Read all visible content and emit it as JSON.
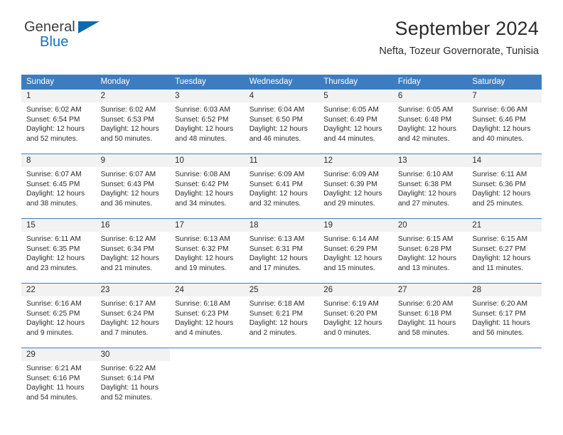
{
  "brand": {
    "word1": "General",
    "word2": "Blue",
    "triangle_icon": "triangle-icon",
    "accent_color": "#1069ae"
  },
  "header": {
    "title": "September 2024",
    "subtitle": "Nefta, Tozeur Governorate, Tunisia"
  },
  "theme": {
    "header_bg": "#3d7dbf",
    "header_text": "#ffffff",
    "daynum_band": "#f2f2f2",
    "row_divider": "#3d7dbf"
  },
  "calendar": {
    "weekday_headers": [
      "Sunday",
      "Monday",
      "Tuesday",
      "Wednesday",
      "Thursday",
      "Friday",
      "Saturday"
    ],
    "weeks": [
      [
        {
          "day": "1",
          "sunrise": "Sunrise: 6:02 AM",
          "sunset": "Sunset: 6:54 PM",
          "daylight1": "Daylight: 12 hours",
          "daylight2": "and 52 minutes."
        },
        {
          "day": "2",
          "sunrise": "Sunrise: 6:02 AM",
          "sunset": "Sunset: 6:53 PM",
          "daylight1": "Daylight: 12 hours",
          "daylight2": "and 50 minutes."
        },
        {
          "day": "3",
          "sunrise": "Sunrise: 6:03 AM",
          "sunset": "Sunset: 6:52 PM",
          "daylight1": "Daylight: 12 hours",
          "daylight2": "and 48 minutes."
        },
        {
          "day": "4",
          "sunrise": "Sunrise: 6:04 AM",
          "sunset": "Sunset: 6:50 PM",
          "daylight1": "Daylight: 12 hours",
          "daylight2": "and 46 minutes."
        },
        {
          "day": "5",
          "sunrise": "Sunrise: 6:05 AM",
          "sunset": "Sunset: 6:49 PM",
          "daylight1": "Daylight: 12 hours",
          "daylight2": "and 44 minutes."
        },
        {
          "day": "6",
          "sunrise": "Sunrise: 6:05 AM",
          "sunset": "Sunset: 6:48 PM",
          "daylight1": "Daylight: 12 hours",
          "daylight2": "and 42 minutes."
        },
        {
          "day": "7",
          "sunrise": "Sunrise: 6:06 AM",
          "sunset": "Sunset: 6:46 PM",
          "daylight1": "Daylight: 12 hours",
          "daylight2": "and 40 minutes."
        }
      ],
      [
        {
          "day": "8",
          "sunrise": "Sunrise: 6:07 AM",
          "sunset": "Sunset: 6:45 PM",
          "daylight1": "Daylight: 12 hours",
          "daylight2": "and 38 minutes."
        },
        {
          "day": "9",
          "sunrise": "Sunrise: 6:07 AM",
          "sunset": "Sunset: 6:43 PM",
          "daylight1": "Daylight: 12 hours",
          "daylight2": "and 36 minutes."
        },
        {
          "day": "10",
          "sunrise": "Sunrise: 6:08 AM",
          "sunset": "Sunset: 6:42 PM",
          "daylight1": "Daylight: 12 hours",
          "daylight2": "and 34 minutes."
        },
        {
          "day": "11",
          "sunrise": "Sunrise: 6:09 AM",
          "sunset": "Sunset: 6:41 PM",
          "daylight1": "Daylight: 12 hours",
          "daylight2": "and 32 minutes."
        },
        {
          "day": "12",
          "sunrise": "Sunrise: 6:09 AM",
          "sunset": "Sunset: 6:39 PM",
          "daylight1": "Daylight: 12 hours",
          "daylight2": "and 29 minutes."
        },
        {
          "day": "13",
          "sunrise": "Sunrise: 6:10 AM",
          "sunset": "Sunset: 6:38 PM",
          "daylight1": "Daylight: 12 hours",
          "daylight2": "and 27 minutes."
        },
        {
          "day": "14",
          "sunrise": "Sunrise: 6:11 AM",
          "sunset": "Sunset: 6:36 PM",
          "daylight1": "Daylight: 12 hours",
          "daylight2": "and 25 minutes."
        }
      ],
      [
        {
          "day": "15",
          "sunrise": "Sunrise: 6:11 AM",
          "sunset": "Sunset: 6:35 PM",
          "daylight1": "Daylight: 12 hours",
          "daylight2": "and 23 minutes."
        },
        {
          "day": "16",
          "sunrise": "Sunrise: 6:12 AM",
          "sunset": "Sunset: 6:34 PM",
          "daylight1": "Daylight: 12 hours",
          "daylight2": "and 21 minutes."
        },
        {
          "day": "17",
          "sunrise": "Sunrise: 6:13 AM",
          "sunset": "Sunset: 6:32 PM",
          "daylight1": "Daylight: 12 hours",
          "daylight2": "and 19 minutes."
        },
        {
          "day": "18",
          "sunrise": "Sunrise: 6:13 AM",
          "sunset": "Sunset: 6:31 PM",
          "daylight1": "Daylight: 12 hours",
          "daylight2": "and 17 minutes."
        },
        {
          "day": "19",
          "sunrise": "Sunrise: 6:14 AM",
          "sunset": "Sunset: 6:29 PM",
          "daylight1": "Daylight: 12 hours",
          "daylight2": "and 15 minutes."
        },
        {
          "day": "20",
          "sunrise": "Sunrise: 6:15 AM",
          "sunset": "Sunset: 6:28 PM",
          "daylight1": "Daylight: 12 hours",
          "daylight2": "and 13 minutes."
        },
        {
          "day": "21",
          "sunrise": "Sunrise: 6:15 AM",
          "sunset": "Sunset: 6:27 PM",
          "daylight1": "Daylight: 12 hours",
          "daylight2": "and 11 minutes."
        }
      ],
      [
        {
          "day": "22",
          "sunrise": "Sunrise: 6:16 AM",
          "sunset": "Sunset: 6:25 PM",
          "daylight1": "Daylight: 12 hours",
          "daylight2": "and 9 minutes."
        },
        {
          "day": "23",
          "sunrise": "Sunrise: 6:17 AM",
          "sunset": "Sunset: 6:24 PM",
          "daylight1": "Daylight: 12 hours",
          "daylight2": "and 7 minutes."
        },
        {
          "day": "24",
          "sunrise": "Sunrise: 6:18 AM",
          "sunset": "Sunset: 6:23 PM",
          "daylight1": "Daylight: 12 hours",
          "daylight2": "and 4 minutes."
        },
        {
          "day": "25",
          "sunrise": "Sunrise: 6:18 AM",
          "sunset": "Sunset: 6:21 PM",
          "daylight1": "Daylight: 12 hours",
          "daylight2": "and 2 minutes."
        },
        {
          "day": "26",
          "sunrise": "Sunrise: 6:19 AM",
          "sunset": "Sunset: 6:20 PM",
          "daylight1": "Daylight: 12 hours",
          "daylight2": "and 0 minutes."
        },
        {
          "day": "27",
          "sunrise": "Sunrise: 6:20 AM",
          "sunset": "Sunset: 6:18 PM",
          "daylight1": "Daylight: 11 hours",
          "daylight2": "and 58 minutes."
        },
        {
          "day": "28",
          "sunrise": "Sunrise: 6:20 AM",
          "sunset": "Sunset: 6:17 PM",
          "daylight1": "Daylight: 11 hours",
          "daylight2": "and 56 minutes."
        }
      ],
      [
        {
          "day": "29",
          "sunrise": "Sunrise: 6:21 AM",
          "sunset": "Sunset: 6:16 PM",
          "daylight1": "Daylight: 11 hours",
          "daylight2": "and 54 minutes."
        },
        {
          "day": "30",
          "sunrise": "Sunrise: 6:22 AM",
          "sunset": "Sunset: 6:14 PM",
          "daylight1": "Daylight: 11 hours",
          "daylight2": "and 52 minutes."
        },
        {
          "day": "",
          "sunrise": "",
          "sunset": "",
          "daylight1": "",
          "daylight2": ""
        },
        {
          "day": "",
          "sunrise": "",
          "sunset": "",
          "daylight1": "",
          "daylight2": ""
        },
        {
          "day": "",
          "sunrise": "",
          "sunset": "",
          "daylight1": "",
          "daylight2": ""
        },
        {
          "day": "",
          "sunrise": "",
          "sunset": "",
          "daylight1": "",
          "daylight2": ""
        },
        {
          "day": "",
          "sunrise": "",
          "sunset": "",
          "daylight1": "",
          "daylight2": ""
        }
      ]
    ]
  }
}
